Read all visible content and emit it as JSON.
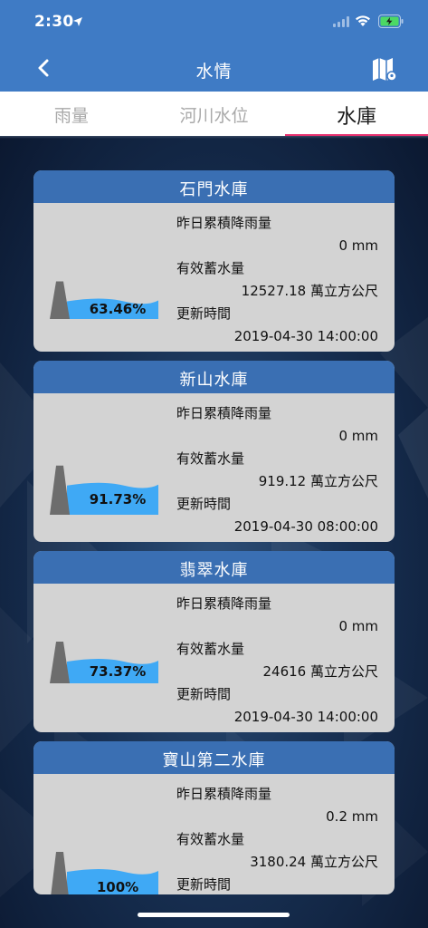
{
  "status_bar": {
    "time": "2:30"
  },
  "nav": {
    "title": "水情"
  },
  "tabs": [
    {
      "label": "雨量",
      "active": false
    },
    {
      "label": "河川水位",
      "active": false
    },
    {
      "label": "水庫",
      "active": true
    }
  ],
  "labels": {
    "rain": "昨日累積降雨量",
    "storage": "有效蓄水量",
    "updated": "更新時間"
  },
  "reservoirs": [
    {
      "name": "石門水庫",
      "percent": "63.46%",
      "level": 0.6346,
      "rain": "0 mm",
      "storage": "12527.18 萬立方公尺",
      "updated": "2019-04-30 14:00:00"
    },
    {
      "name": "新山水庫",
      "percent": "91.73%",
      "level": 0.9173,
      "rain": "0 mm",
      "storage": "919.12 萬立方公尺",
      "updated": "2019-04-30 08:00:00"
    },
    {
      "name": "翡翠水庫",
      "percent": "73.37%",
      "level": 0.7337,
      "rain": "0 mm",
      "storage": "24616 萬立方公尺",
      "updated": "2019-04-30 14:00:00"
    },
    {
      "name": "寶山第二水庫",
      "percent": "100%",
      "level": 1.0,
      "rain": "0.2 mm",
      "storage": "3180.24 萬立方公尺",
      "updated": ""
    }
  ],
  "colors": {
    "header": "#3f7bc5",
    "card_header": "#3a6fb3",
    "card_body": "#d3d3d3",
    "water": "#3fa9f5",
    "dam": "#6d6d6d",
    "tab_indicator": "#e7316f"
  }
}
